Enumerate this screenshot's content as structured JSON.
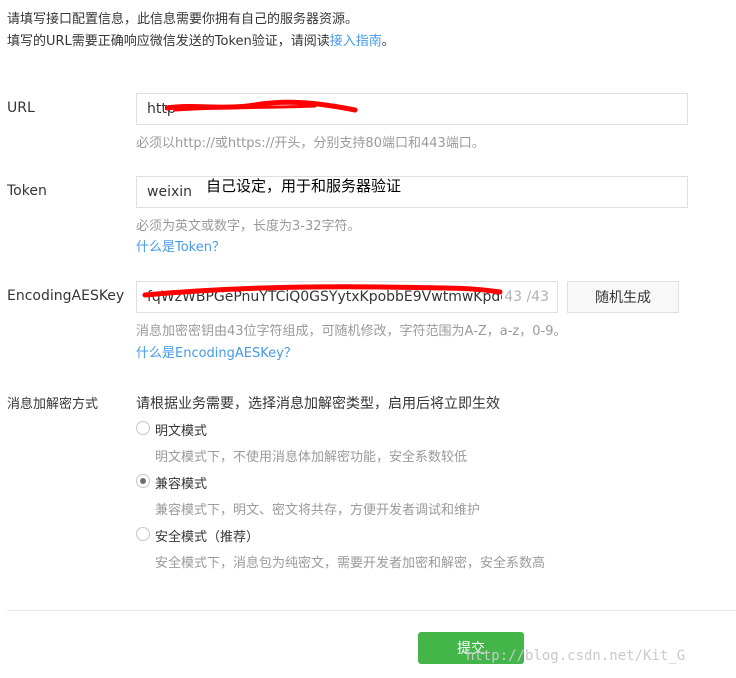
{
  "intro": {
    "line1": "请填写接口配置信息，此信息需要你拥有自己的服务器资源。",
    "line2_prefix": "填写的URL需要正确响应微信发送的Token验证，请阅读",
    "line2_link": "接入指南",
    "line2_suffix": "。"
  },
  "url": {
    "label": "URL",
    "value": "http",
    "hint": "必须以http://或https://开头，分别支持80端口和443端口。"
  },
  "token": {
    "label": "Token",
    "value": "weixin",
    "hint": "必须为英文或数字，长度为3-32字符。",
    "link": "什么是Token？",
    "annotation": "自己设定，用于和服务器验证"
  },
  "aes": {
    "label": "EncodingAESKey",
    "value": "fqWzWBPGePnuYTCiQ0GSYytxKpobbE9VwtmwKpdc",
    "counter": "43 /43",
    "generate_label": "随机生成",
    "hint": "消息加密密钥由43位字符组成，可随机修改，字符范围为A-Z，a-z，0-9。",
    "link": "什么是EncodingAESKey？"
  },
  "mode": {
    "label": "消息加解密方式",
    "description": "请根据业务需要，选择消息加解密类型，启用后将立即生效",
    "selected": "compatible",
    "options": [
      {
        "label": "明文模式",
        "hint": "明文模式下，不使用消息体加解密功能，安全系数较低"
      },
      {
        "label": "兼容模式",
        "hint": "兼容模式下，明文、密文将共存，方便开发者调试和维护"
      },
      {
        "label": "安全模式（推荐）",
        "hint": "安全模式下，消息包为纯密文，需要开发者加密和解密，安全系数高"
      }
    ]
  },
  "submit_label": "提交",
  "watermark": "http://blog.csdn.net/Kit_G",
  "colors": {
    "accent_green": "#44b549",
    "link_blue": "#459ae9",
    "redaction_red": "#ff0000"
  }
}
